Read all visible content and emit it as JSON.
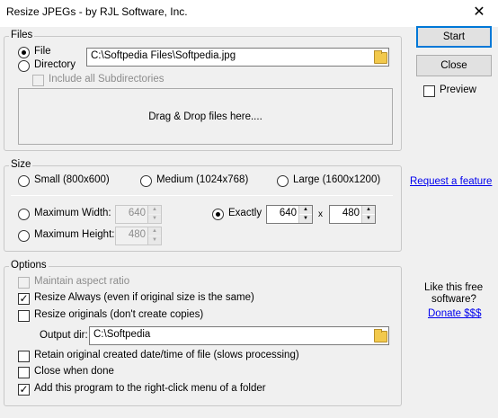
{
  "window": {
    "title": "Resize JPEGs - by RJL Software, Inc.",
    "close_glyph": "✕"
  },
  "files": {
    "group_title": "Files",
    "file_radio": "File",
    "directory_radio": "Directory",
    "selected": "file",
    "path_value": "C:\\Softpedia Files\\Softpedia.jpg",
    "include_subdirectories_label": "Include all Subdirectories",
    "include_subdirectories_checked": false,
    "dropzone_text": "Drag & Drop files here...."
  },
  "size": {
    "group_title": "Size",
    "small_label": "Small (800x600)",
    "medium_label": "Medium (1024x768)",
    "large_label": "Large (1600x1200)",
    "max_width_label": "Maximum Width:",
    "max_width_value": "640",
    "max_height_label": "Maximum Height:",
    "max_height_value": "480",
    "exactly_label": "Exactly",
    "exact_width_value": "640",
    "exact_x": "x",
    "exact_height_value": "480",
    "selected": "exactly"
  },
  "options": {
    "group_title": "Options",
    "maintain_aspect_label": "Maintain aspect ratio",
    "maintain_aspect_checked": false,
    "resize_always_label": "Resize Always (even if original size is the same)",
    "resize_always_checked": true,
    "resize_originals_label": "Resize originals (don't create copies)",
    "resize_originals_checked": false,
    "output_dir_label": "Output dir:",
    "output_dir_value": "C:\\Softpedia",
    "retain_date_label": "Retain original created date/time of file (slows processing)",
    "retain_date_checked": false,
    "close_when_done_label": "Close when done",
    "close_when_done_checked": false,
    "add_to_menu_label": "Add this program to the right-click menu of a folder",
    "add_to_menu_checked": true
  },
  "side": {
    "start_label": "Start",
    "close_label": "Close",
    "preview_label": "Preview",
    "preview_checked": false,
    "request_feature_link": "Request a feature",
    "like_text_line1": "Like this free",
    "like_text_line2": "software?",
    "donate_link": "Donate $$$"
  },
  "glyphs": {
    "check": "✓",
    "spin_up": "▲",
    "spin_down": "▼"
  },
  "colors": {
    "client_background": "#f0f0f0",
    "link": "#0000ee",
    "default_button_border": "#0078d7",
    "disabled_text": "#8c8c8c",
    "folder_icon": "#f2c94c"
  }
}
